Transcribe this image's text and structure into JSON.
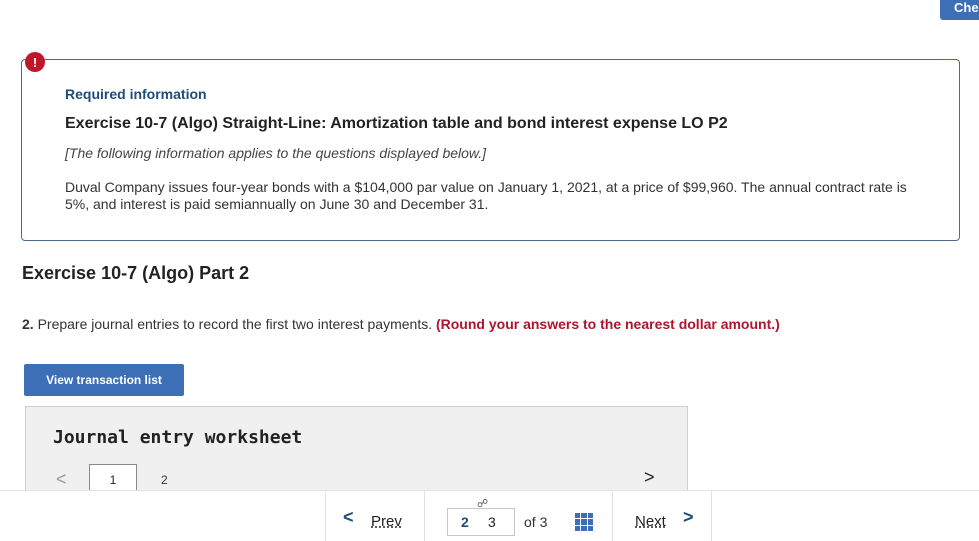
{
  "header": {
    "check_label": "Che"
  },
  "info": {
    "alert_symbol": "!",
    "required_label": "Required information",
    "exercise_title": "Exercise 10-7 (Algo) Straight-Line: Amortization table and bond interest expense LO P2",
    "applies_text": "[The following information applies to the questions displayed below.]",
    "description": "Duval Company issues four-year bonds with a $104,000 par value on January 1, 2021, at a price of $99,960. The annual contract rate is 5%, and interest is paid semiannually on June 30 and December 31."
  },
  "part": {
    "title": "Exercise 10-7 (Algo) Part 2",
    "question_number": "2.",
    "question_text": "Prepare journal entries to record the first two interest payments.",
    "question_note": "(Round your answers to the nearest dollar amount.)"
  },
  "buttons": {
    "view_transactions": "View transaction list"
  },
  "worksheet": {
    "title": "Journal entry worksheet",
    "prev_arrow": "<",
    "next_arrow": ">",
    "pages": [
      "1",
      "2"
    ]
  },
  "footer": {
    "prev_chevron": "<",
    "prev_label": "Prev",
    "link_icon": "☍",
    "current_page": "2",
    "next_page": "3",
    "of_text": "of 3",
    "next_label": "Next",
    "next_chevron": ">"
  },
  "colors": {
    "primary_blue": "#3d6fb6",
    "title_blue": "#1f4d7a",
    "alert_red": "#c0182b",
    "note_red": "#b0142c"
  },
  "icons": [
    "alert-icon",
    "link-icon",
    "grid-icon",
    "chevron-left-icon",
    "chevron-right-icon"
  ]
}
